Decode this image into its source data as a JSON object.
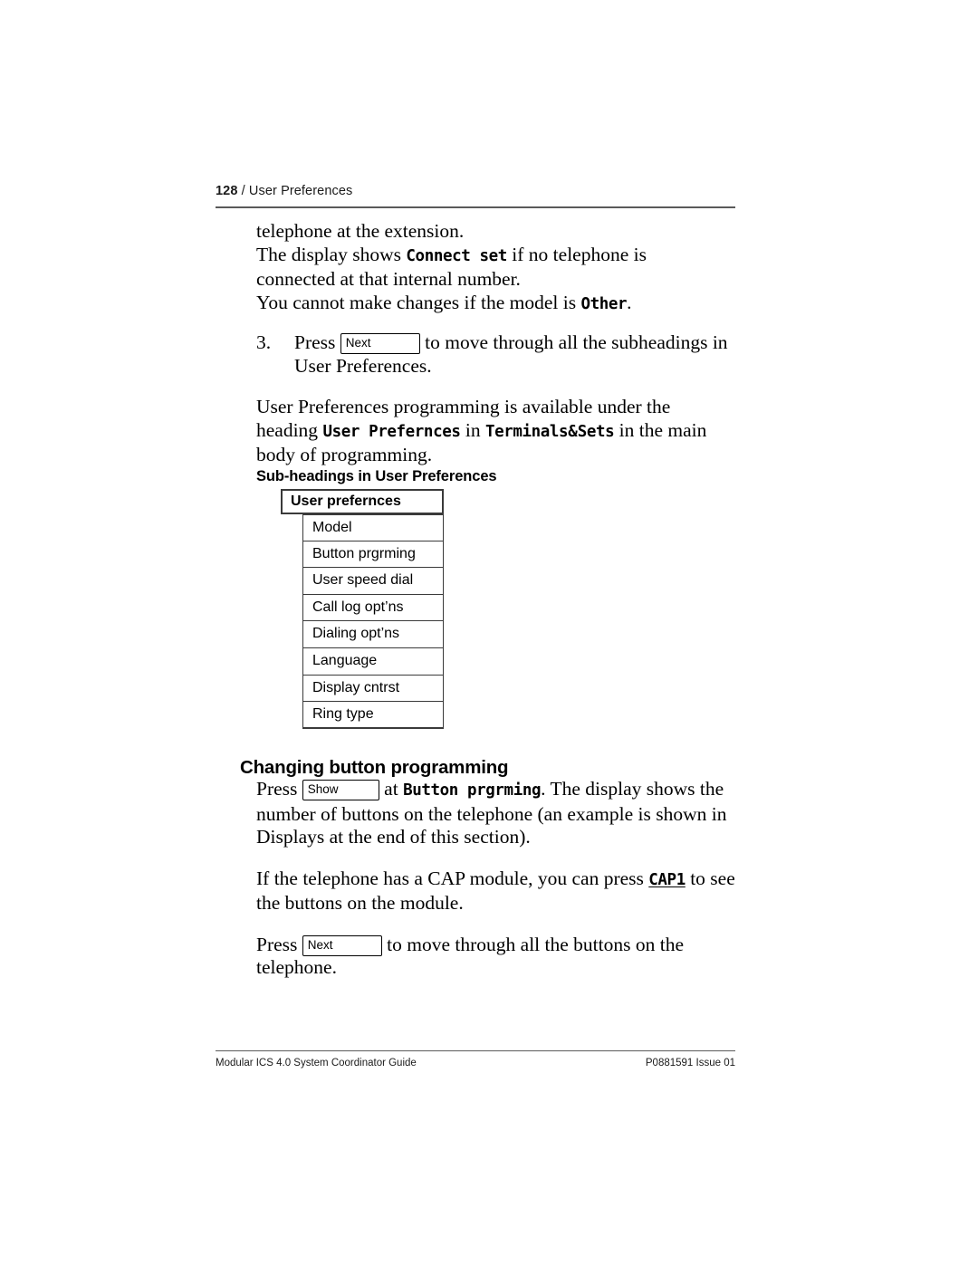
{
  "running_head": {
    "page_number": "128",
    "separator": "/",
    "section": "User Preferences"
  },
  "body": {
    "para1_line1": "telephone at the extension.",
    "para1_line2_pre": "The display shows ",
    "para1_display1": "Connect set",
    "para1_line2_post": " if no telephone is",
    "para1_line3": "connected at that internal number.",
    "para1_line4_pre": "You cannot make changes if the model is ",
    "para1_display2": "Other",
    "para1_line4_post": ".",
    "step3_number": "3.",
    "step3_pre": "Press",
    "step3_key": "Next",
    "step3_post": "to move through all the subheadings in User Preferences.",
    "para2_pre": "User Preferences programming is available under the heading ",
    "para2_display1": "User Prefernces",
    "para2_mid": " in ",
    "para2_display2a": "Terminals",
    "para2_display2b": "&",
    "para2_display2c": "Sets",
    "para2_post": " in the main body of programming."
  },
  "table": {
    "caption": "Sub-headings in User Preferences",
    "header": "User prefernces",
    "rows": [
      "Model",
      "Button prgrming",
      "User speed dial",
      "Call log opt’ns",
      "Dialing opt’ns",
      "Language",
      "Display cntrst",
      "Ring type"
    ]
  },
  "section": {
    "heading": "Changing button programming",
    "para1_pre": "Press",
    "para1_key": "Show",
    "para1_mid": "at ",
    "para1_display": "Button prgrming",
    "para1_post": ". The display shows the number of buttons on the telephone (an example is shown in Displays at the end of this section).",
    "para2_pre": "If the telephone has a CAP module, you can press ",
    "para2_display": "CAP1",
    "para2_post": " to see the buttons on the module.",
    "para3_pre": "Press",
    "para3_key": "Next",
    "para3_post": "to move through all the buttons on the telephone."
  },
  "footer": {
    "left": "Modular ICS 4.0 System Coordinator Guide",
    "right": "P0881591 Issue 01"
  }
}
